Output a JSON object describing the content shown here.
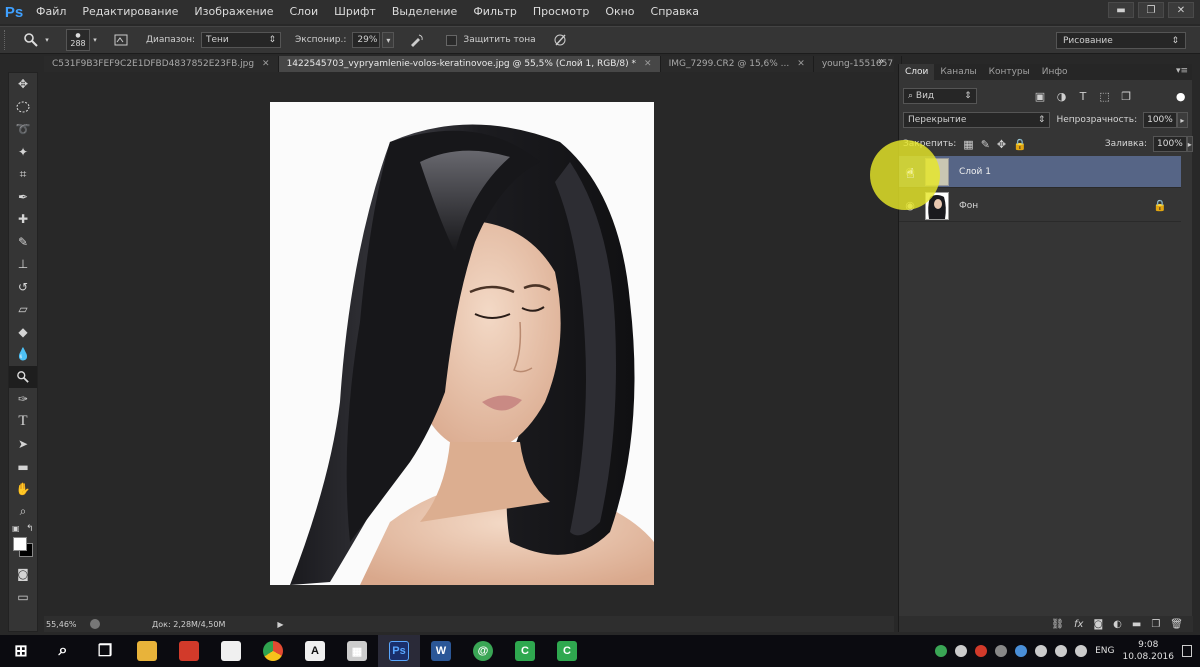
{
  "app": {
    "logo": "Ps"
  },
  "menu": [
    "Файл",
    "Редактирование",
    "Изображение",
    "Слои",
    "Шрифт",
    "Выделение",
    "Фильтр",
    "Просмотр",
    "Окно",
    "Справка"
  ],
  "window_buttons": {
    "minimize": "▬",
    "restore": "❐",
    "close": "✕"
  },
  "options": {
    "brush_size": "288",
    "range_label": "Диапазон:",
    "range_value": "Тени",
    "exposure_label": "Экспонир.:",
    "exposure_value": "29%",
    "protect_label": "Защитить тона",
    "workspace": "Рисование"
  },
  "tabs": [
    {
      "label": "C531F9B3FEF9C2E1DFBD4837852E23FB.jpg",
      "active": false
    },
    {
      "label": "1422545703_vypryamlenie-volos-keratinovoe.jpg @ 55,5% (Слой 1, RGB/8) *",
      "active": true
    },
    {
      "label": "IMG_7299.CR2 @ 15,6% ...",
      "active": false
    },
    {
      "label": "young-1551657",
      "active": false
    }
  ],
  "tabs_more": "»",
  "status": {
    "zoom": "55,46%",
    "doc": "Док: 2,28M/4,50M",
    "arrow": "▶"
  },
  "panel": {
    "tabs": [
      "Слои",
      "Каналы",
      "Контуры",
      "Инфо"
    ],
    "filter_label": "Вид",
    "blend_mode": "Перекрытие",
    "opacity_label": "Непрозрачность:",
    "opacity_value": "100%",
    "lock_label": "Закрепить:",
    "fill_label": "Заливка:",
    "fill_value": "100%",
    "layers": [
      {
        "name": "Слой 1",
        "selected": true
      },
      {
        "name": "Фон",
        "selected": false
      }
    ]
  },
  "taskbar": {
    "apps": [
      {
        "name": "start",
        "glyph": "⊞",
        "color": "#ffffff"
      },
      {
        "name": "search",
        "glyph": "⌕",
        "color": "#ffffff"
      },
      {
        "name": "task-view",
        "glyph": "❒",
        "color": "#ffffff"
      },
      {
        "name": "explorer",
        "glyph": "",
        "color": "#e8b33a"
      },
      {
        "name": "app-red-green",
        "glyph": "",
        "color": "#d23a2a"
      },
      {
        "name": "camera",
        "glyph": "",
        "color": "#ffffff"
      },
      {
        "name": "chrome",
        "glyph": "",
        "color": "#e34b32"
      },
      {
        "name": "font-a",
        "glyph": "A",
        "color": "#ffffff"
      },
      {
        "name": "calculator",
        "glyph": "▦",
        "color": "#cccccc"
      },
      {
        "name": "photoshop",
        "glyph": "Ps",
        "color": "#1a2f6b"
      },
      {
        "name": "word",
        "glyph": "W",
        "color": "#2b5797"
      },
      {
        "name": "mail",
        "glyph": "@",
        "color": "#3aa655"
      },
      {
        "name": "green-c",
        "glyph": "C",
        "color": "#2fa84f"
      },
      {
        "name": "green-c-2",
        "glyph": "C",
        "color": "#2fa84f"
      }
    ],
    "lang": "ENG",
    "time": "9:08",
    "date": "10.08.2016"
  }
}
